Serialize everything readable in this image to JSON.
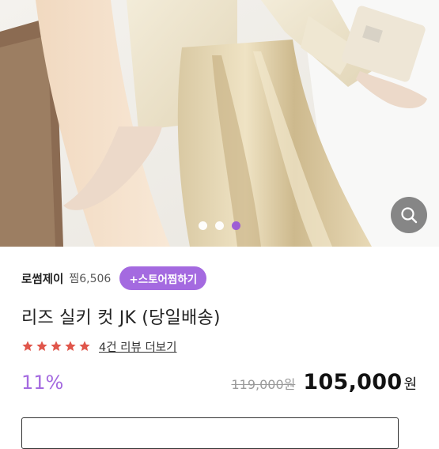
{
  "product": {
    "shop_name": "로썸제이",
    "like_count": "찜6,506",
    "follow_label": "+스토어찜하기",
    "title": "리즈 실키 컷 JK (당일배송)",
    "rating": 5,
    "review_link": "4건 리뷰 더보기",
    "discount": "11%",
    "original_price": "119,000원",
    "sale_price": "105,000",
    "currency": "원"
  },
  "gallery": {
    "total_images": 3,
    "active_index": 2
  },
  "icons": {
    "zoom": "magnifier-icon",
    "star": "star-icon"
  },
  "colors": {
    "accent": "#a46ae0",
    "star": "#e0564b",
    "strike": "#9a9a9a"
  }
}
